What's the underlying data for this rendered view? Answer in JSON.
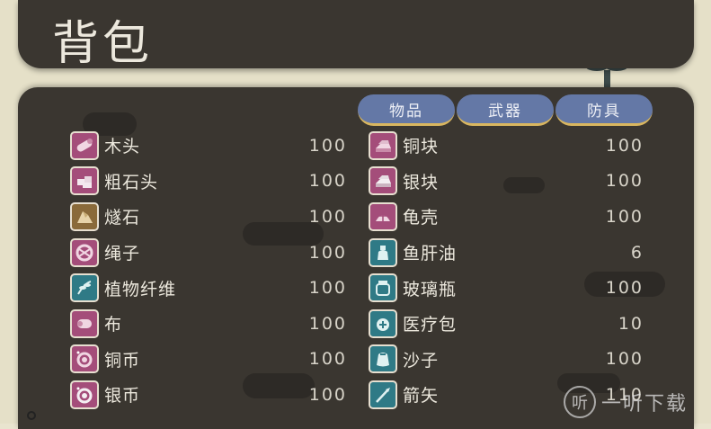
{
  "title": "背包",
  "tabs": [
    {
      "label": "物品"
    },
    {
      "label": "武器"
    },
    {
      "label": "防具"
    }
  ],
  "colors": {
    "panel": "#3a3630",
    "tab": "#6478a6",
    "icon_material": "#a44d7a",
    "icon_mineral": "#8a6a3a",
    "icon_plant": "#2f7a86"
  },
  "items_left": [
    {
      "name": "木头",
      "qty": "100",
      "icon": "wood-log-icon",
      "color": "#a44d7a"
    },
    {
      "name": "粗石头",
      "qty": "100",
      "icon": "rough-stone-icon",
      "color": "#a44d7a"
    },
    {
      "name": "燧石",
      "qty": "100",
      "icon": "flint-icon",
      "color": "#8a6a3a"
    },
    {
      "name": "绳子",
      "qty": "100",
      "icon": "rope-icon",
      "color": "#a44d7a"
    },
    {
      "name": "植物纤维",
      "qty": "100",
      "icon": "plant-fiber-icon",
      "color": "#2f7a86"
    },
    {
      "name": "布",
      "qty": "100",
      "icon": "cloth-roll-icon",
      "color": "#a44d7a"
    },
    {
      "name": "铜币",
      "qty": "100",
      "icon": "copper-coin-icon",
      "color": "#a44d7a"
    },
    {
      "name": "银币",
      "qty": "100",
      "icon": "silver-coin-icon",
      "color": "#a44d7a"
    }
  ],
  "items_right": [
    {
      "name": "铜块",
      "qty": "100",
      "icon": "copper-ingot-icon",
      "color": "#a44d7a"
    },
    {
      "name": "银块",
      "qty": "100",
      "icon": "silver-ingot-icon",
      "color": "#a44d7a"
    },
    {
      "name": "龟壳",
      "qty": "100",
      "icon": "turtle-shell-icon",
      "color": "#a44d7a"
    },
    {
      "name": "鱼肝油",
      "qty": "6",
      "icon": "fish-oil-bottle-icon",
      "color": "#2f7a86"
    },
    {
      "name": "玻璃瓶",
      "qty": "100",
      "icon": "glass-jar-icon",
      "color": "#2f7a86"
    },
    {
      "name": "医疗包",
      "qty": "10",
      "icon": "medkit-icon",
      "color": "#2f7a86"
    },
    {
      "name": "沙子",
      "qty": "100",
      "icon": "sand-bag-icon",
      "color": "#2f7a86"
    },
    {
      "name": "箭矢",
      "qty": "110",
      "icon": "arrow-icon",
      "color": "#2f7a86"
    }
  ],
  "watermark": {
    "badge": "听",
    "text": "一听下载"
  }
}
